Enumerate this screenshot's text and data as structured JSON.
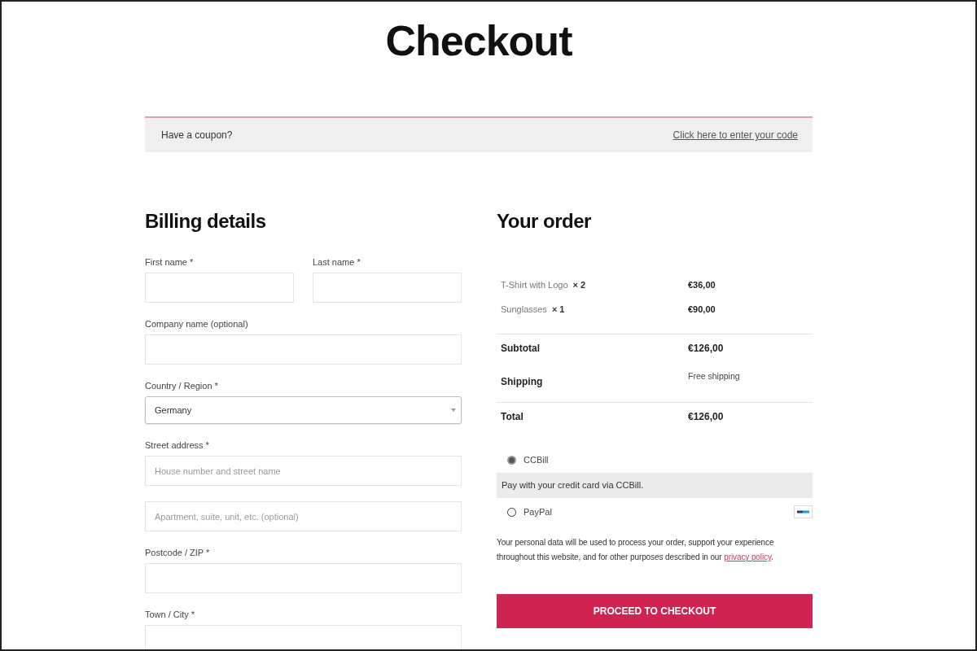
{
  "page": {
    "title": "Checkout"
  },
  "coupon_notice": {
    "text": "Have a coupon?",
    "link": "Click here to enter your code"
  },
  "billing": {
    "heading": "Billing details",
    "rows": [
      {
        "fields": [
          {
            "kind": "text",
            "label": "First name *"
          },
          {
            "kind": "text",
            "label": "Last name *"
          }
        ]
      },
      {
        "fields": [
          {
            "kind": "text",
            "label": "Company name (optional)"
          }
        ]
      },
      {
        "fields": [
          {
            "kind": "select",
            "label": "Country / Region *",
            "value": "Germany"
          }
        ]
      },
      {
        "fields": [
          {
            "kind": "text",
            "label": "Street address *",
            "placeholder": "House number and street name"
          }
        ]
      },
      {
        "fields": [
          {
            "kind": "text",
            "placeholder": "Apartment, suite, unit, etc. (optional)"
          }
        ]
      },
      {
        "fields": [
          {
            "kind": "text",
            "label": "Postcode / ZIP *"
          }
        ]
      },
      {
        "fields": [
          {
            "kind": "text",
            "label": "Town / City *"
          }
        ]
      }
    ]
  },
  "order": {
    "heading": "Your order",
    "items": [
      {
        "name": "T-Shirt with Logo",
        "quantity": "× 2",
        "price": "€36,00"
      },
      {
        "name": "Sunglasses",
        "quantity": "× 1",
        "price": "€90,00"
      }
    ],
    "totals": [
      {
        "kind": "subtotal",
        "label": "Subtotal",
        "value": "€126,00"
      },
      {
        "kind": "shipping",
        "label": "Shipping",
        "value": "Free shipping"
      },
      {
        "kind": "total",
        "label": "Total",
        "value": "€126,00"
      }
    ]
  },
  "payment": {
    "methods": [
      {
        "label": "CCBill",
        "selected": true,
        "logo": false,
        "description": "Pay with your credit card via CCBill."
      },
      {
        "label": "PayPal",
        "selected": false,
        "logo": true
      }
    ]
  },
  "privacy_notice": {
    "text": "Your personal data will be used to process your order, support your experience throughout this website, and for other purposes described in our",
    "link": "privacy policy",
    "text_after": "."
  },
  "checkout_button": {
    "label": "PROCEED TO CHECKOUT"
  }
}
